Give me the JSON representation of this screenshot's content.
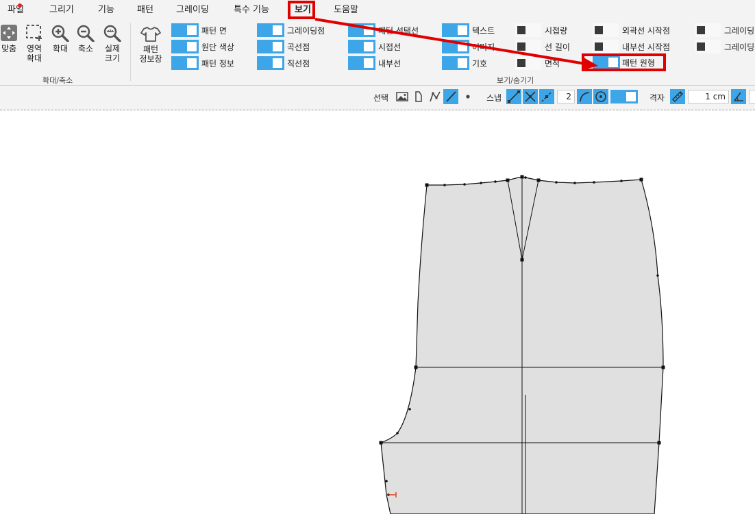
{
  "menu": {
    "items": [
      "파일",
      "그리기",
      "기능",
      "패턴",
      "그레이딩",
      "특수 기능",
      "보기",
      "도움말"
    ]
  },
  "ribbon": {
    "zoom_tools": {
      "fit": "맞춤",
      "area_zoom": "영역\n확대",
      "zoom_in": "확대",
      "zoom_out": "축소",
      "actual_size": "실제\n크기"
    },
    "zoom_group_label": "확대/축소",
    "pattern_info": "패턴\n정보창",
    "view_group_label": "보기/숨기기",
    "options": [
      {
        "label": "패턴 면",
        "type": "toggle",
        "on": true
      },
      {
        "label": "원단 색상",
        "type": "toggle",
        "on": true
      },
      {
        "label": "패턴 정보",
        "type": "toggle",
        "on": true
      },
      {
        "label": "그레이딩점",
        "type": "toggle",
        "on": true
      },
      {
        "label": "곡선점",
        "type": "toggle",
        "on": true
      },
      {
        "label": "직선점",
        "type": "toggle",
        "on": true
      },
      {
        "label": "패턴 선택선",
        "type": "toggle",
        "on": true
      },
      {
        "label": "시접선",
        "type": "toggle",
        "on": true
      },
      {
        "label": "내부선",
        "type": "toggle",
        "on": true
      },
      {
        "label": "텍스트",
        "type": "toggle",
        "on": true
      },
      {
        "label": "이미지",
        "type": "toggle",
        "on": true
      },
      {
        "label": "기호",
        "type": "toggle",
        "on": true
      },
      {
        "label": "시접량",
        "type": "check",
        "on": false
      },
      {
        "label": "선 길이",
        "type": "check",
        "on": false
      },
      {
        "label": "면적",
        "type": "check",
        "on": false
      },
      {
        "label": "외곽선 시작점",
        "type": "check",
        "on": false
      },
      {
        "label": "내부선 시작점",
        "type": "check",
        "on": false
      },
      {
        "label": "패턴 원형",
        "type": "toggle",
        "on": true
      },
      {
        "label": "그레이딩",
        "type": "check",
        "on": false
      },
      {
        "label": "그레이딩",
        "type": "check",
        "on": false
      }
    ]
  },
  "toolbar": {
    "select_label": "선택",
    "snap_label": "스냅",
    "snap_value": "2",
    "grid_label": "격자",
    "grid_value": "1 cm"
  },
  "colors": {
    "accent": "#3ca6e8",
    "highlight": "#e00000",
    "pattern_fill": "#e0e0e0"
  }
}
